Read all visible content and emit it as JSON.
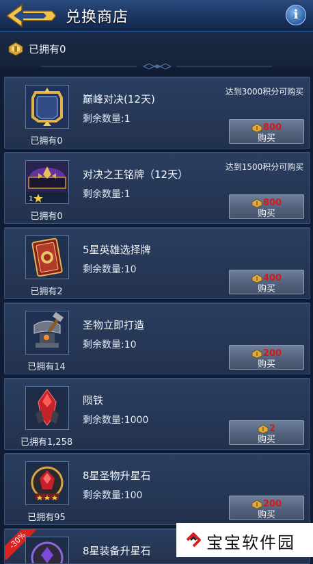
{
  "header": {
    "title": "兑换商店",
    "info_symbol": "i"
  },
  "summary": {
    "owned_currency": "已拥有0"
  },
  "items": [
    {
      "name": "巅峰对决(12天)",
      "stock": "剩余数量:1",
      "owned": "已拥有0",
      "requirement": "达到3000积分可购买",
      "price": "800",
      "buy_label": "购买",
      "icon": "frame-icon"
    },
    {
      "name": "对决之王铭牌（12天）",
      "stock": "剩余数量:1",
      "owned": "已拥有0",
      "requirement": "达到1500积分可购买",
      "price": "800",
      "buy_label": "购买",
      "icon": "nameplate-icon",
      "level_badge": "1"
    },
    {
      "name": "5星英雄选择牌",
      "stock": "剩余数量:10",
      "owned": "已拥有2",
      "requirement": "",
      "price": "400",
      "buy_label": "购买",
      "icon": "hero-card-icon"
    },
    {
      "name": "圣物立即打造",
      "stock": "剩余数量:10",
      "owned": "已拥有14",
      "requirement": "",
      "price": "200",
      "buy_label": "购买",
      "icon": "anvil-hammer-icon"
    },
    {
      "name": "陨铁",
      "stock": "剩余数量:1000",
      "owned": "已拥有1,258",
      "requirement": "",
      "price": "2",
      "buy_label": "购买",
      "icon": "meteor-iron-icon"
    },
    {
      "name": "8星圣物升星石",
      "stock": "剩余数量:100",
      "owned": "已拥有95",
      "requirement": "",
      "price": "200",
      "buy_label": "购买",
      "icon": "star-stone-icon"
    },
    {
      "name": "8星装备升星石",
      "stock": "",
      "owned": "",
      "requirement": "",
      "price": "",
      "buy_label": "",
      "icon": "equip-stone-icon",
      "discount": "-30%"
    }
  ],
  "watermark": {
    "text": "宝宝软件园"
  },
  "colors": {
    "price": "#d21a1a",
    "header": "#1b335e",
    "card": "#263755"
  }
}
